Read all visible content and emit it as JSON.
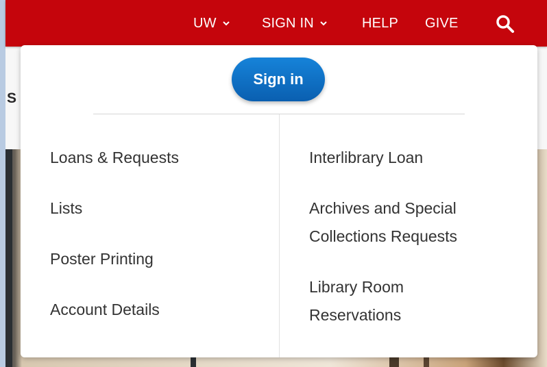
{
  "header": {
    "nav": [
      {
        "label": "UW",
        "has_dropdown": true
      },
      {
        "label": "SIGN IN",
        "has_dropdown": true
      },
      {
        "label": "HELP",
        "has_dropdown": false
      },
      {
        "label": "GIVE",
        "has_dropdown": false
      }
    ],
    "search_icon": "search-icon",
    "bar_color": "#c5050c"
  },
  "page": {
    "heading_fragment": "S"
  },
  "dropdown": {
    "sign_in_label": "Sign in",
    "left_links": [
      "Loans & Requests",
      "Lists",
      "Poster Printing",
      "Account Details"
    ],
    "right_links": [
      "Interlibrary Loan",
      "Archives and Special Collections Requests",
      "Library Room Reservations"
    ]
  },
  "colors": {
    "sign_in_button": "#0f6fc6",
    "link_text": "#333333"
  }
}
